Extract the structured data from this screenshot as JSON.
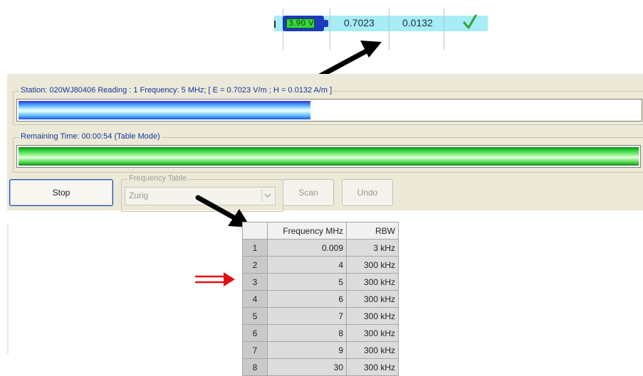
{
  "top_row": {
    "battery_voltage": "3.90 V",
    "e_value": "0.7023",
    "h_value": "0.0132",
    "status_icon": "check-icon"
  },
  "progress": {
    "station_label": "Station: 020WJ80406 Reading : 1 Frequency: 5 MHz; [ E = 0.7023  V/m ; H = 0.0132  A/m ]",
    "station_progress_fraction": 0.47,
    "remaining_label": "Remaining Time: 00:00:54 (Table Mode)",
    "remaining_progress_fraction": 1.0
  },
  "controls": {
    "stop_label": "Stop",
    "frequency_table_label": "Frequency Table",
    "frequency_table_value": "Zurig",
    "scan_label": "Scan",
    "undo_label": "Undo"
  },
  "table": {
    "headers": [
      "",
      "Frequency MHz",
      "RBW"
    ],
    "rows": [
      {
        "idx": "1",
        "freq": "0.009",
        "rbw": "3 kHz"
      },
      {
        "idx": "2",
        "freq": "4",
        "rbw": "300 kHz"
      },
      {
        "idx": "3",
        "freq": "5",
        "rbw": "300 kHz"
      },
      {
        "idx": "4",
        "freq": "6",
        "rbw": "300 kHz"
      },
      {
        "idx": "5",
        "freq": "7",
        "rbw": "300 kHz"
      },
      {
        "idx": "6",
        "freq": "8",
        "rbw": "300 kHz"
      },
      {
        "idx": "7",
        "freq": "9",
        "rbw": "300 kHz"
      },
      {
        "idx": "8",
        "freq": "30",
        "rbw": "300 kHz"
      }
    ]
  },
  "colors": {
    "arrow": "#000000",
    "highlight_arrow": "#e01010",
    "station_bar": "#3d7cff",
    "remaining_bar": "#33d63f"
  }
}
